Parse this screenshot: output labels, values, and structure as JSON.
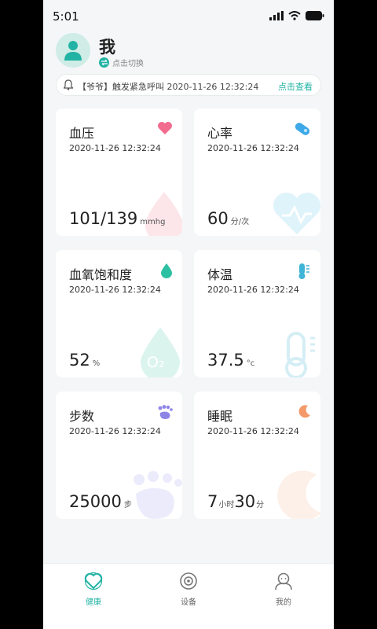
{
  "status_bar": {
    "time": "5:01"
  },
  "header": {
    "name": "我",
    "switch_label": "点击切换"
  },
  "notice": {
    "text": "【爷爷】触发紧急呼叫 2020-11-26 12:32:24",
    "link": "点击查看"
  },
  "cards": [
    {
      "title": "血压",
      "time": "2020-11-26 12:32:24",
      "value": "101/139",
      "unit": "mmhg",
      "icon": "heart-icon",
      "color": "#f26c8f"
    },
    {
      "title": "心率",
      "time": "2020-11-26 12:32:24",
      "value": "60",
      "unit": "分/次",
      "icon": "pill-icon",
      "color": "#3fa9e8"
    },
    {
      "title": "血氧饱和度",
      "time": "2020-11-26 12:32:24",
      "value": "52",
      "unit": "%",
      "icon": "drop-icon",
      "color": "#2cc0a3"
    },
    {
      "title": "体温",
      "time": "2020-11-26 12:32:24",
      "value": "37.5",
      "unit": "°c",
      "icon": "thermometer-icon",
      "color": "#3fb4d6"
    },
    {
      "title": "步数",
      "time": "2020-11-26 12:32:24",
      "value": "25000",
      "unit": "步",
      "icon": "footprint-icon",
      "color": "#8d86e6"
    },
    {
      "title": "睡眠",
      "time": "2020-11-26 12:32:24",
      "value_h": "7",
      "unit_h": "小时",
      "value_m": "30",
      "unit_m": "分",
      "icon": "moon-icon",
      "color": "#f49a6a"
    }
  ],
  "tabs": [
    {
      "label": "健康",
      "icon": "health-icon",
      "active": true
    },
    {
      "label": "设备",
      "icon": "device-icon",
      "active": false
    },
    {
      "label": "我的",
      "icon": "profile-icon",
      "active": false
    }
  ],
  "colors": {
    "accent": "#22b3a4",
    "background": "#f4f6f7"
  }
}
